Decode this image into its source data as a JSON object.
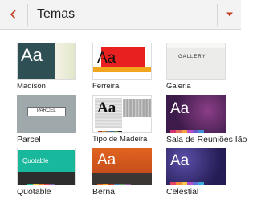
{
  "header": {
    "title": "Temas",
    "back_icon": "chevron-left-icon",
    "dropdown_icon": "caret-down-icon",
    "accent": "#c43e1c"
  },
  "themes": [
    {
      "name": "Madison",
      "thumb_text": "Aa"
    },
    {
      "name": "Ferreira",
      "thumb_text": "Aa"
    },
    {
      "name": "Galeria",
      "thumb_text": "GALLERY"
    },
    {
      "name": "Parcel",
      "thumb_text": "PARCEL"
    },
    {
      "name": "Tipo de Madeira",
      "thumb_text": "Aa"
    },
    {
      "name": "Sala de Reuniões Ião",
      "thumb_text": "Aa"
    },
    {
      "name": "Quotable",
      "thumb_text": "Quotable"
    },
    {
      "name": "Berna",
      "thumb_text": "Aa"
    },
    {
      "name": "Celestial",
      "thumb_text": "Aa"
    }
  ]
}
